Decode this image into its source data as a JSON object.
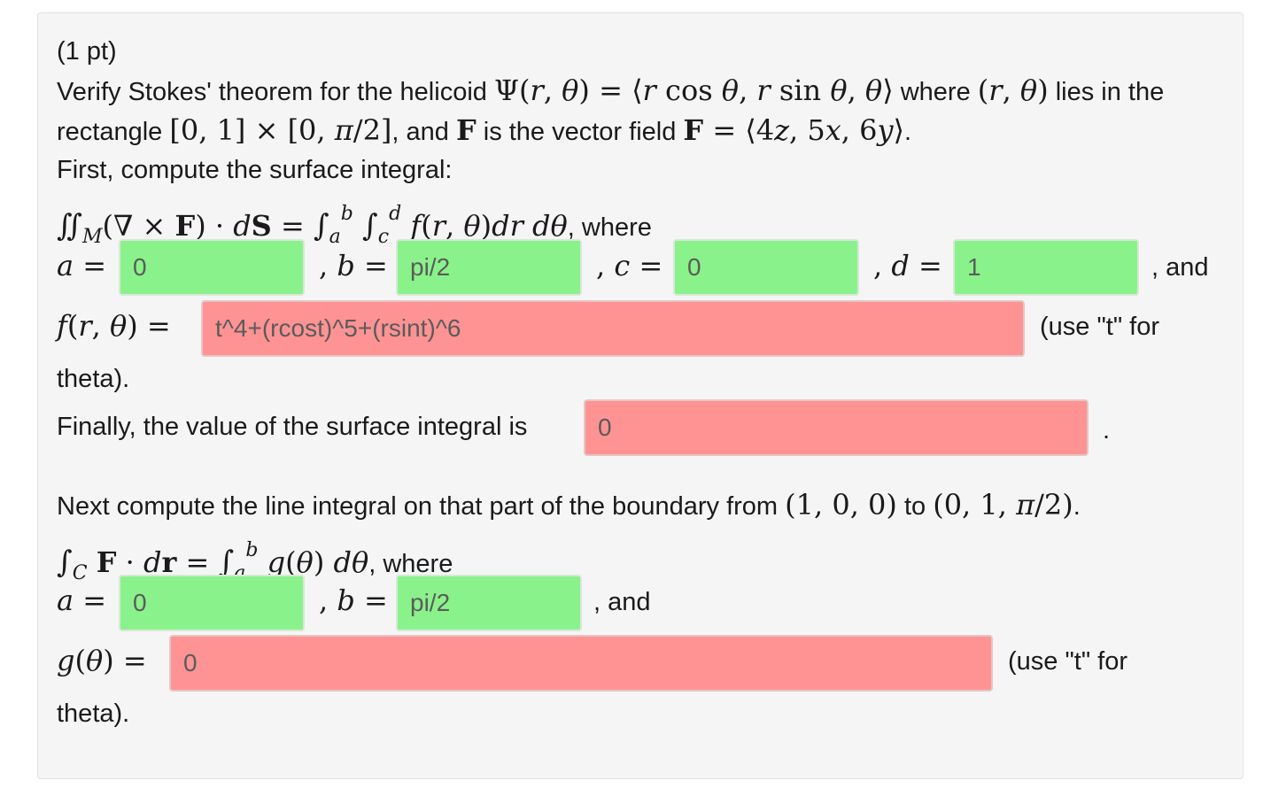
{
  "problem": {
    "points": "(1 pt)",
    "intro_1": "Verify Stokes' theorem for the helicoid",
    "where_text": "where",
    "lies_in_the": "lies in the",
    "rectangle_word": "rectangle",
    "and_text": ", and",
    "is_the_vector_field": "is the vector field",
    "first_compute": "First, compute the surface integral:",
    "where_comma": ", where",
    "and_tail": ", and",
    "use_t_for": "(use \"t\" for",
    "theta_end": "theta).",
    "finally_text": "Finally, the value of the surface integral is",
    "period": ".",
    "next_compute": "Next compute the line integral on that part of the boundary from",
    "to_text": "to",
    "comma": ","
  },
  "surface": {
    "a_value": "0",
    "b_value": "pi/2",
    "c_value": "0",
    "d_value": "1",
    "f_value": "t^4+(rcost)^5+(rsint)^6",
    "integral_value": "0"
  },
  "line": {
    "a_value": "0",
    "b_value": "pi/2",
    "g_value": "0"
  },
  "colors": {
    "correct": "#8af28a",
    "incorrect": "#ff9393",
    "card_bg": "#f5f5f5"
  }
}
